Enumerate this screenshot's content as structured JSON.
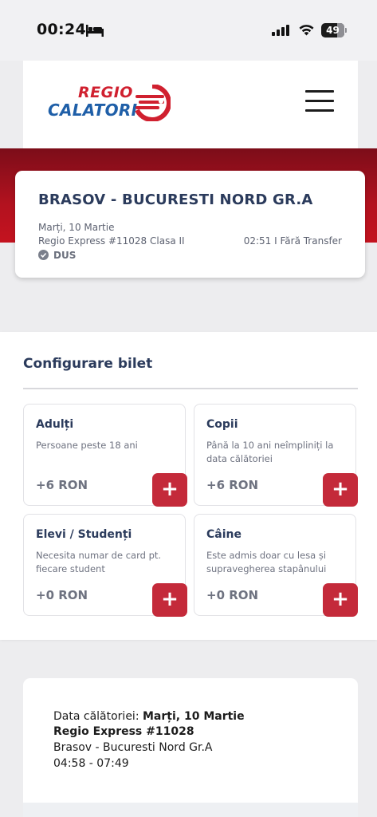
{
  "status_bar": {
    "time": "00:24",
    "battery": "49"
  },
  "header": {
    "logo_top": "REGIO",
    "logo_bottom": "CALATORI"
  },
  "route": {
    "title": "BRASOV - BUCURESTI NORD GR.A",
    "date": "Marți, 10 Martie",
    "train": "Regio Express #11028 Clasa II",
    "duration": "02:51 I Fără Transfer",
    "direction": "DUS"
  },
  "config": {
    "title": "Configurare bilet",
    "passengers": [
      {
        "title": "Adulți",
        "desc": "Persoane peste 18 ani",
        "price": "+6 RON",
        "add": "+"
      },
      {
        "title": "Copii",
        "desc": "Până la 10 ani neîmpliniți la data călătoriei",
        "price": "+6 RON",
        "add": "+"
      },
      {
        "title": "Elevi / Studenți",
        "desc": "Necesita numar de card pt. fiecare student",
        "price": "+0 RON",
        "add": "+"
      },
      {
        "title": "Câine",
        "desc": "Este admis doar cu lesa și supravegherea stapânului",
        "price": "+0 RON",
        "add": "+"
      }
    ]
  },
  "summary": {
    "date_label": "Data călătoriei: ",
    "date_value": "Marți, 10 Martie",
    "train": "Regio Express #11028",
    "route": "Brasov - Bucuresti Nord Gr.A",
    "time": "04:58 - 07:49"
  },
  "colors": {
    "brand_red": "#c42a3a",
    "brand_blue": "#1f5fa8",
    "heading_navy": "#2b3b5c"
  }
}
